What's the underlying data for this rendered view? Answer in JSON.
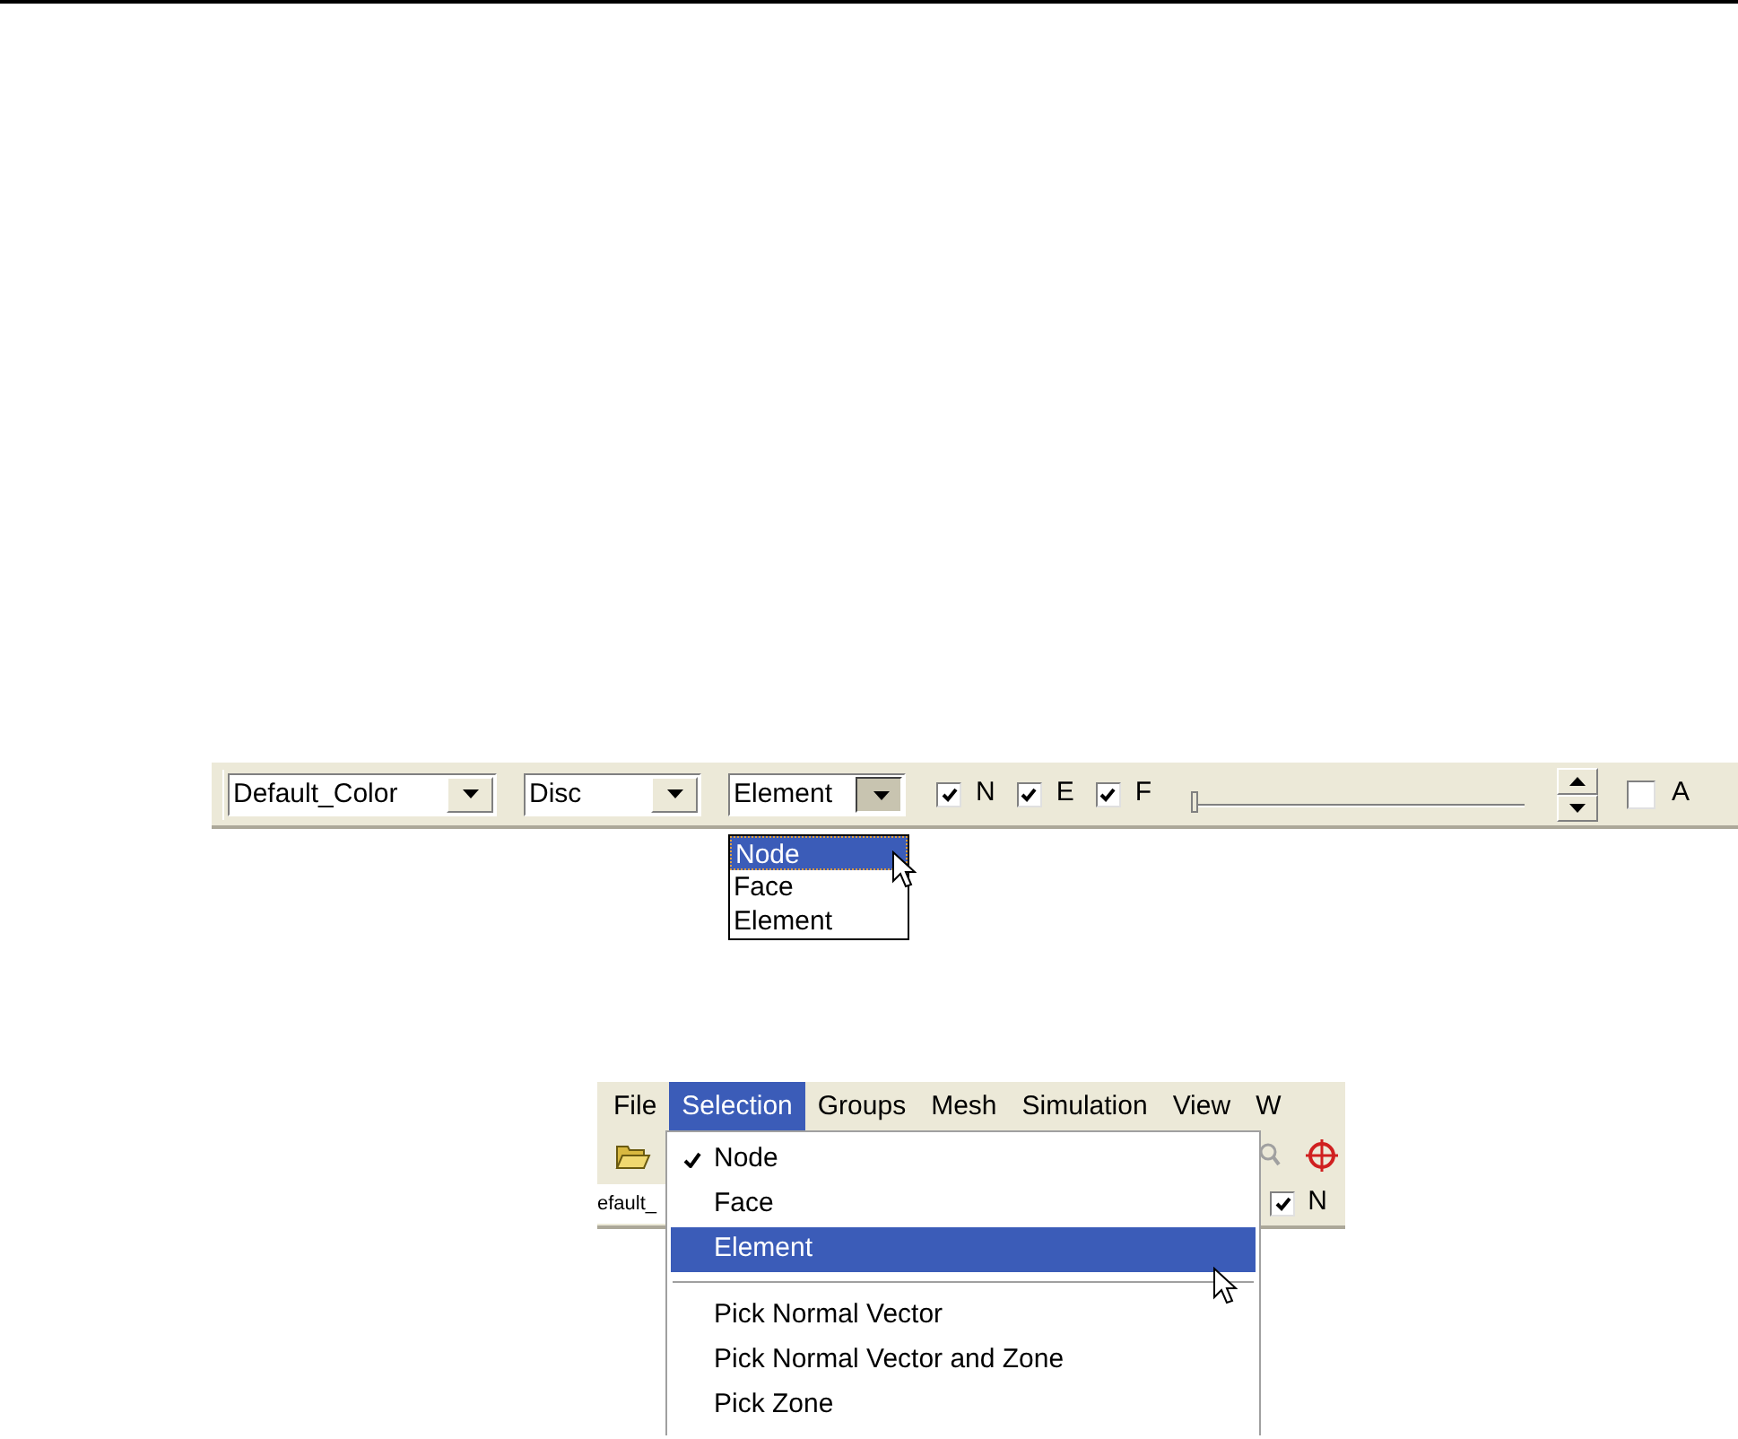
{
  "toolbar": {
    "combos": [
      {
        "value": "Default_Color",
        "expanded": false
      },
      {
        "value": "Disc",
        "expanded": false
      },
      {
        "value": "Element",
        "expanded": true
      }
    ],
    "dropdown_options": [
      {
        "label": "Node",
        "selected": true
      },
      {
        "label": "Face",
        "selected": false
      },
      {
        "label": "Element",
        "selected": false
      }
    ],
    "checkboxes": [
      {
        "label": "N",
        "checked": true
      },
      {
        "label": "E",
        "checked": true
      },
      {
        "label": "F",
        "checked": true
      }
    ],
    "slider": {
      "level": 0
    },
    "toggle": {
      "label": "A",
      "checked": false
    }
  },
  "app_window": {
    "menubar": [
      {
        "label": "File",
        "selected": false
      },
      {
        "label": "Selection",
        "selected": true
      },
      {
        "label": "Groups",
        "selected": false
      },
      {
        "label": "Mesh",
        "selected": false
      },
      {
        "label": "Simulation",
        "selected": false
      },
      {
        "label": "View",
        "selected": false
      },
      {
        "label": "W",
        "selected": false
      }
    ],
    "field_value": "efault_",
    "checkbox": {
      "label": "N",
      "checked": true
    },
    "menu": [
      {
        "kind": "item",
        "label": "Node",
        "checked": true,
        "selected": false
      },
      {
        "kind": "item",
        "label": "Face",
        "checked": false,
        "selected": false
      },
      {
        "kind": "item",
        "label": "Element",
        "checked": false,
        "selected": true
      },
      {
        "kind": "separator"
      },
      {
        "kind": "item",
        "label": "Pick Normal Vector",
        "checked": false,
        "selected": false
      },
      {
        "kind": "item",
        "label": "Pick Normal Vector and Zone",
        "checked": false,
        "selected": false
      },
      {
        "kind": "item",
        "label": "Pick Zone",
        "checked": false,
        "selected": false
      }
    ]
  }
}
